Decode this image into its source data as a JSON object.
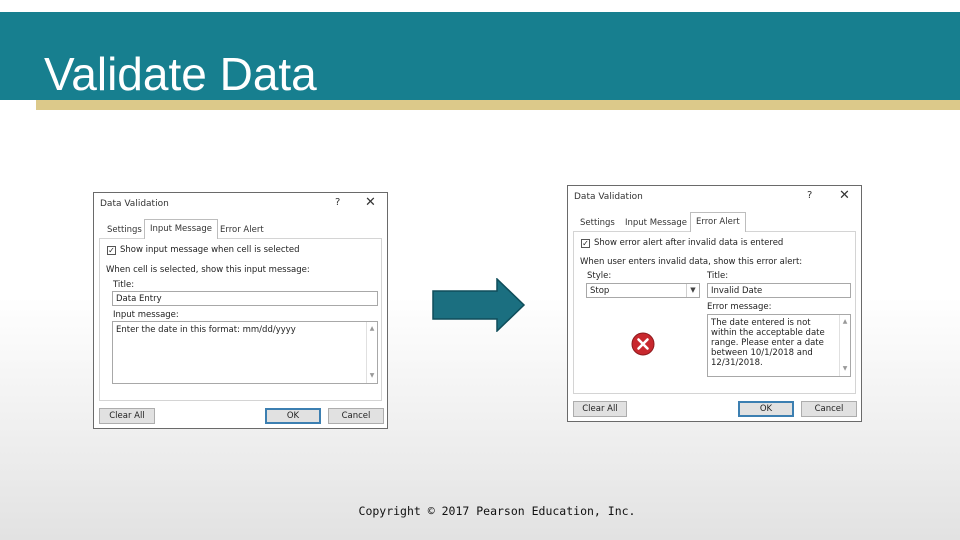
{
  "slide": {
    "title": "Validate Data",
    "copyright": "Copyright © 2017 Pearson Education, Inc."
  },
  "dialog_left": {
    "title": "Data Validation",
    "help": "?",
    "close": "✕",
    "tabs": [
      "Settings",
      "Input Message",
      "Error Alert"
    ],
    "active_tab": "Input Message",
    "checkbox_label": "Show input message when cell is selected",
    "checkbox_checked": true,
    "section_label": "When cell is selected, show this input message:",
    "title_label": "Title:",
    "title_value": "Data Entry",
    "message_label": "Input message:",
    "message_value": "Enter the date in this format: mm/dd/yyyy",
    "buttons": {
      "clear_all": "Clear All",
      "ok": "OK",
      "cancel": "Cancel"
    }
  },
  "dialog_right": {
    "title": "Data Validation",
    "help": "?",
    "close": "✕",
    "tabs": [
      "Settings",
      "Input Message",
      "Error Alert"
    ],
    "active_tab": "Error Alert",
    "checkbox_label": "Show error alert after invalid data is entered",
    "checkbox_checked": true,
    "section_label": "When user enters invalid data, show this error alert:",
    "style_label": "Style:",
    "style_value": "Stop",
    "title_label": "Title:",
    "title_value": "Invalid Date",
    "message_label": "Error message:",
    "message_value": "The date entered is not within the acceptable date range. Please enter a date between 10/1/2018 and 12/31/2018.",
    "buttons": {
      "clear_all": "Clear All",
      "ok": "OK",
      "cancel": "Cancel"
    }
  },
  "icons": {
    "arrow": "right-arrow-icon",
    "stop": "stop-error-icon"
  },
  "colors": {
    "title_bar": "#177f8f",
    "title_underline": "#dcc98a",
    "arrow_fill": "#1b6f80",
    "stop_red": "#c8282e"
  }
}
